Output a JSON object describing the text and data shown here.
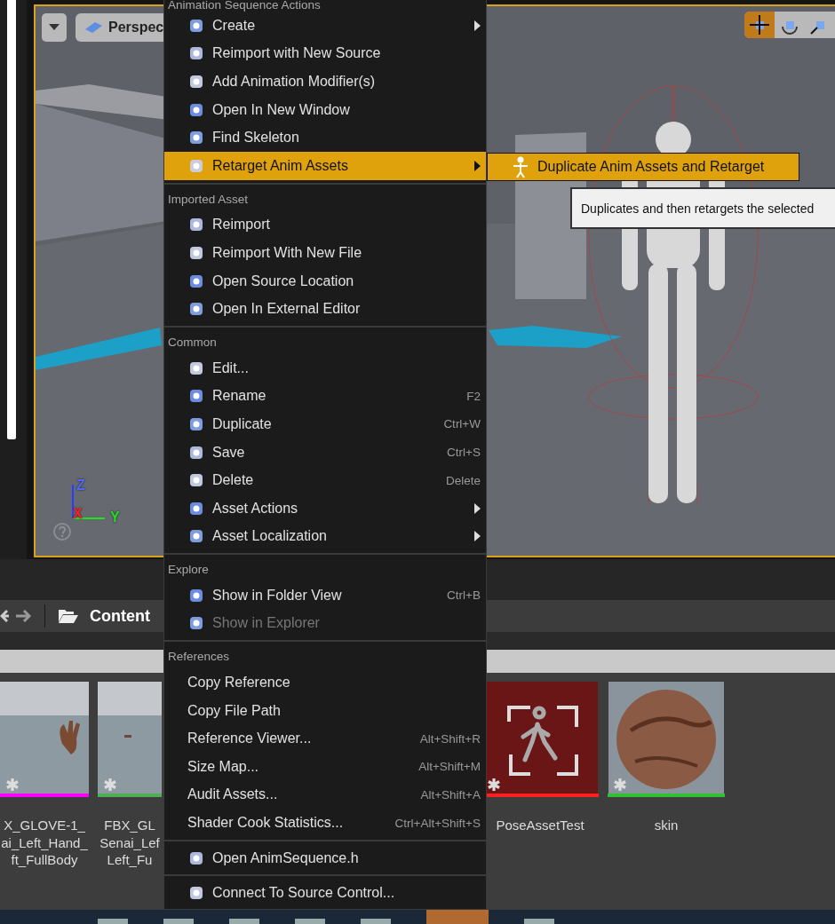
{
  "viewport": {
    "view_button": "Perspec",
    "axis_labels": [
      {
        "text": "Z",
        "color": "#5068ff"
      },
      {
        "text": "X",
        "color": "#ff2020"
      },
      {
        "text": "Y",
        "color": "#20e020"
      }
    ],
    "transform_tools": [
      {
        "selected": true
      },
      {
        "selected": false
      },
      {
        "selected": false
      }
    ]
  },
  "context_menu": {
    "sections": [
      {
        "title": "Animation Sequence Actions",
        "items": [
          {
            "kind": "icon",
            "label": "Create",
            "submenu": true,
            "selected": false,
            "disabled": false
          },
          {
            "kind": "icon",
            "label": "Reimport with New Source",
            "submenu": false,
            "selected": false,
            "disabled": false
          },
          {
            "kind": "icon",
            "label": "Add Animation Modifier(s)",
            "submenu": false,
            "selected": false,
            "disabled": false
          },
          {
            "kind": "icon",
            "label": "Open In New Window",
            "submenu": false,
            "selected": false,
            "disabled": false
          },
          {
            "kind": "icon",
            "label": "Find Skeleton",
            "submenu": false,
            "selected": false,
            "disabled": false
          },
          {
            "kind": "icon",
            "label": "Retarget Anim Assets",
            "submenu": true,
            "selected": true,
            "disabled": false
          }
        ]
      },
      {
        "title": "Imported Asset",
        "items": [
          {
            "kind": "icon",
            "label": "Reimport",
            "submenu": false,
            "selected": false,
            "disabled": false
          },
          {
            "kind": "icon",
            "label": "Reimport With New File",
            "submenu": false,
            "selected": false,
            "disabled": false
          },
          {
            "kind": "icon",
            "label": "Open Source Location",
            "submenu": false,
            "selected": false,
            "disabled": false
          },
          {
            "kind": "icon",
            "label": "Open In External Editor",
            "submenu": false,
            "selected": false,
            "disabled": false
          }
        ]
      },
      {
        "title": "Common",
        "items": [
          {
            "kind": "icon",
            "label": "Edit...",
            "submenu": false,
            "selected": false,
            "disabled": false
          },
          {
            "kind": "icon",
            "label": "Rename",
            "shortcut": "F2",
            "submenu": false,
            "selected": false,
            "disabled": false
          },
          {
            "kind": "icon",
            "label": "Duplicate",
            "shortcut": "Ctrl+W",
            "submenu": false,
            "selected": false,
            "disabled": false
          },
          {
            "kind": "icon",
            "label": "Save",
            "shortcut": "Ctrl+S",
            "submenu": false,
            "selected": false,
            "disabled": false
          },
          {
            "kind": "icon",
            "label": "Delete",
            "shortcut": "Delete",
            "submenu": false,
            "selected": false,
            "disabled": false
          },
          {
            "kind": "icon",
            "label": "Asset Actions",
            "submenu": true,
            "selected": false,
            "disabled": false
          },
          {
            "kind": "icon",
            "label": "Asset Localization",
            "submenu": true,
            "selected": false,
            "disabled": false
          }
        ]
      },
      {
        "title": "Explore",
        "items": [
          {
            "kind": "icon",
            "label": "Show in Folder View",
            "shortcut": "Ctrl+B",
            "submenu": false,
            "selected": false,
            "disabled": false
          },
          {
            "kind": "icon",
            "label": "Show in Explorer",
            "submenu": false,
            "selected": false,
            "disabled": true
          }
        ]
      },
      {
        "title": "References",
        "items": [
          {
            "kind": "text",
            "label": "Copy Reference",
            "submenu": false,
            "selected": false,
            "disabled": false
          },
          {
            "kind": "text",
            "label": "Copy File Path",
            "submenu": false,
            "selected": false,
            "disabled": false
          },
          {
            "kind": "text",
            "label": "Reference Viewer...",
            "shortcut": "Alt+Shift+R",
            "submenu": false,
            "selected": false,
            "disabled": false
          },
          {
            "kind": "text",
            "label": "Size Map...",
            "shortcut": "Alt+Shift+M",
            "submenu": false,
            "selected": false,
            "disabled": false
          },
          {
            "kind": "text",
            "label": "Audit Assets...",
            "shortcut": "Alt+Shift+A",
            "submenu": false,
            "selected": false,
            "disabled": false
          },
          {
            "kind": "text",
            "label": "Shader Cook Statistics...",
            "shortcut": "Ctrl+Alt+Shift+S",
            "submenu": false,
            "selected": false,
            "disabled": false
          }
        ]
      },
      {
        "items": [
          {
            "kind": "icon",
            "label": "Open AnimSequence.h",
            "submenu": false,
            "selected": false,
            "disabled": false
          }
        ]
      },
      {
        "items": [
          {
            "kind": "icon",
            "label": "Connect To Source Control...",
            "submenu": false,
            "selected": false,
            "disabled": false
          }
        ]
      }
    ]
  },
  "submenu": {
    "items": [
      {
        "label": "Duplicate Anim Assets and Retarget",
        "selected": true
      }
    ]
  },
  "tooltip": {
    "text": "Duplicates and then retargets the selected"
  },
  "content_browser": {
    "path": "Content",
    "assets": [
      {
        "kind": "hands",
        "name": "X_GLOVE-1_\nai_Left_Hand_\nft_FullBody",
        "color": "#ff00ff"
      },
      {
        "kind": "floor",
        "name": "FBX_GL\nSenai_Lef\nLeft_Fu",
        "color": "#4caf50"
      },
      {
        "kind": "pose",
        "name": "PoseAssetTest",
        "color": "#ff2020"
      },
      {
        "kind": "sphere",
        "name": "skin",
        "color": "#30c030"
      }
    ]
  }
}
